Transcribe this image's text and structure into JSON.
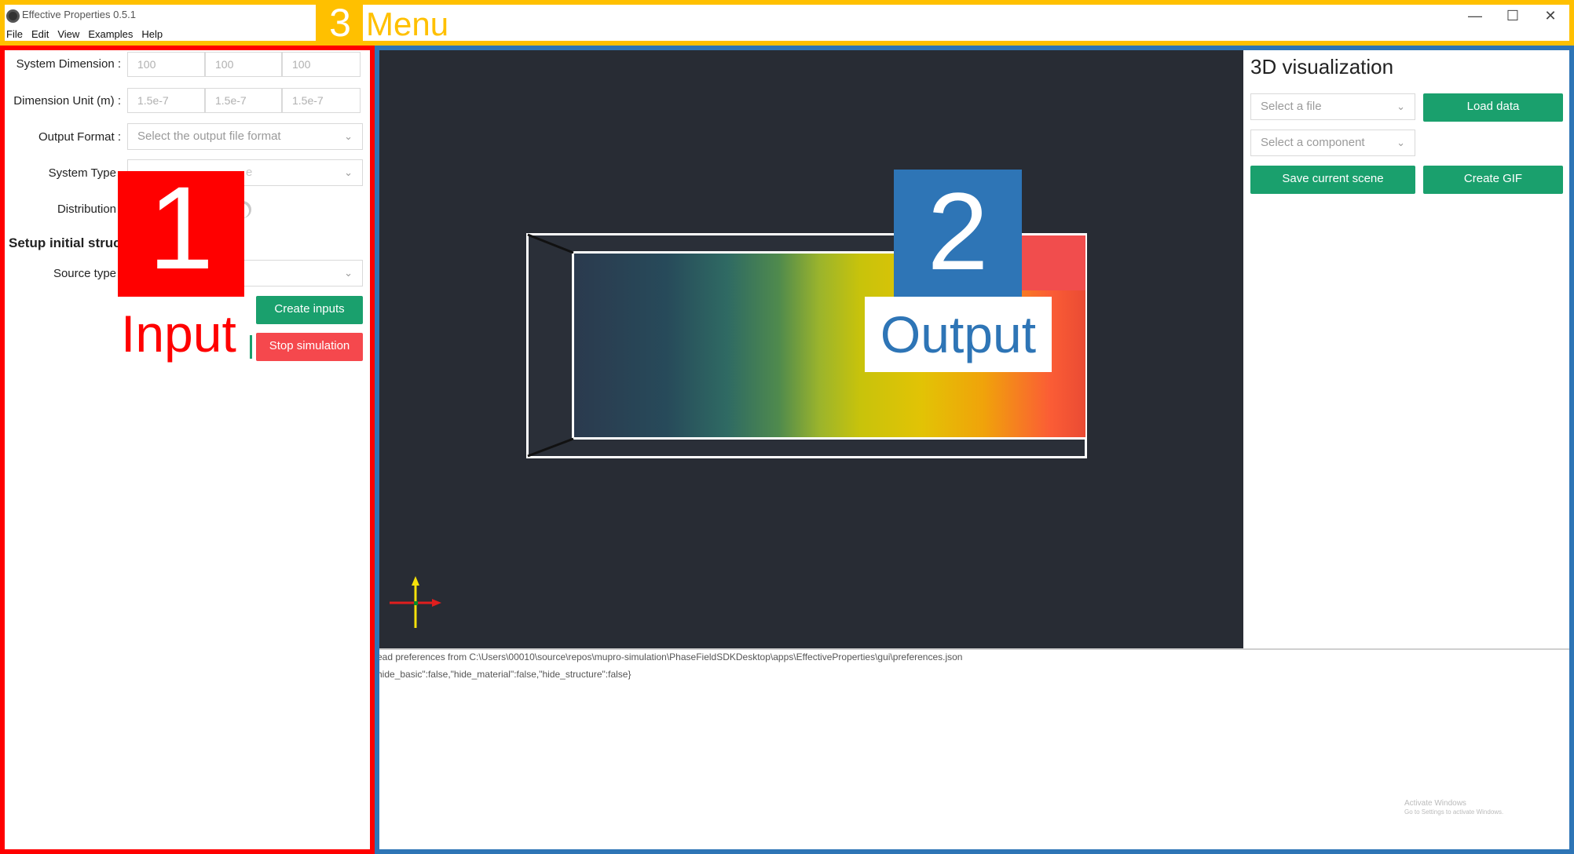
{
  "app": {
    "title": "Effective Properties 0.5.1",
    "menu": [
      "File",
      "Edit",
      "View",
      "Examples",
      "Help"
    ],
    "window_controls": {
      "minimize": "—",
      "maximize": "☐",
      "close": "✕"
    }
  },
  "annotations": {
    "menu_number": "3",
    "menu_label": "Menu",
    "input_number": "1",
    "input_label": "Input",
    "output_number": "2",
    "output_label": "Output",
    "colors": {
      "menu": "#ffc000",
      "input": "#ff0000",
      "output": "#2e75b6"
    }
  },
  "input_panel": {
    "system_dimension_label": "System Dimension :",
    "system_dimension_values": [
      "100",
      "100",
      "100"
    ],
    "dimension_unit_label": "Dimension Unit (m) :",
    "dimension_unit_values": [
      "1.5e-7",
      "1.5e-7",
      "1.5e-7"
    ],
    "output_format_label": "Output Format :",
    "output_format_placeholder": "Select the output file format",
    "system_type_label": "System Type",
    "system_type_partial": "e",
    "distribution_label": "Distribution",
    "setup_heading": "Setup initial struct",
    "source_type_label": "Source type",
    "create_inputs": "Create inputs",
    "stop_simulation": "Stop simulation",
    "button_colors": {
      "create": "#1aa06d",
      "stop": "#f5484d"
    }
  },
  "visualization": {
    "title": "3D visualization",
    "file_select_placeholder": "Select a file",
    "component_select_placeholder": "Select a component",
    "load_data": "Load data",
    "save_scene": "Save current scene",
    "create_gif": "Create GIF"
  },
  "log": {
    "lines": [
      "ead preferences from C:\\Users\\00010\\source\\repos\\mupro-simulation\\PhaseFieldSDKDesktop\\apps\\EffectiveProperties\\gui\\preferences.json",
      "hide_basic\":false,\"hide_material\":false,\"hide_structure\":false}"
    ]
  },
  "watermark": {
    "line1": "Activate Windows",
    "line2": "Go to Settings to activate Windows."
  }
}
